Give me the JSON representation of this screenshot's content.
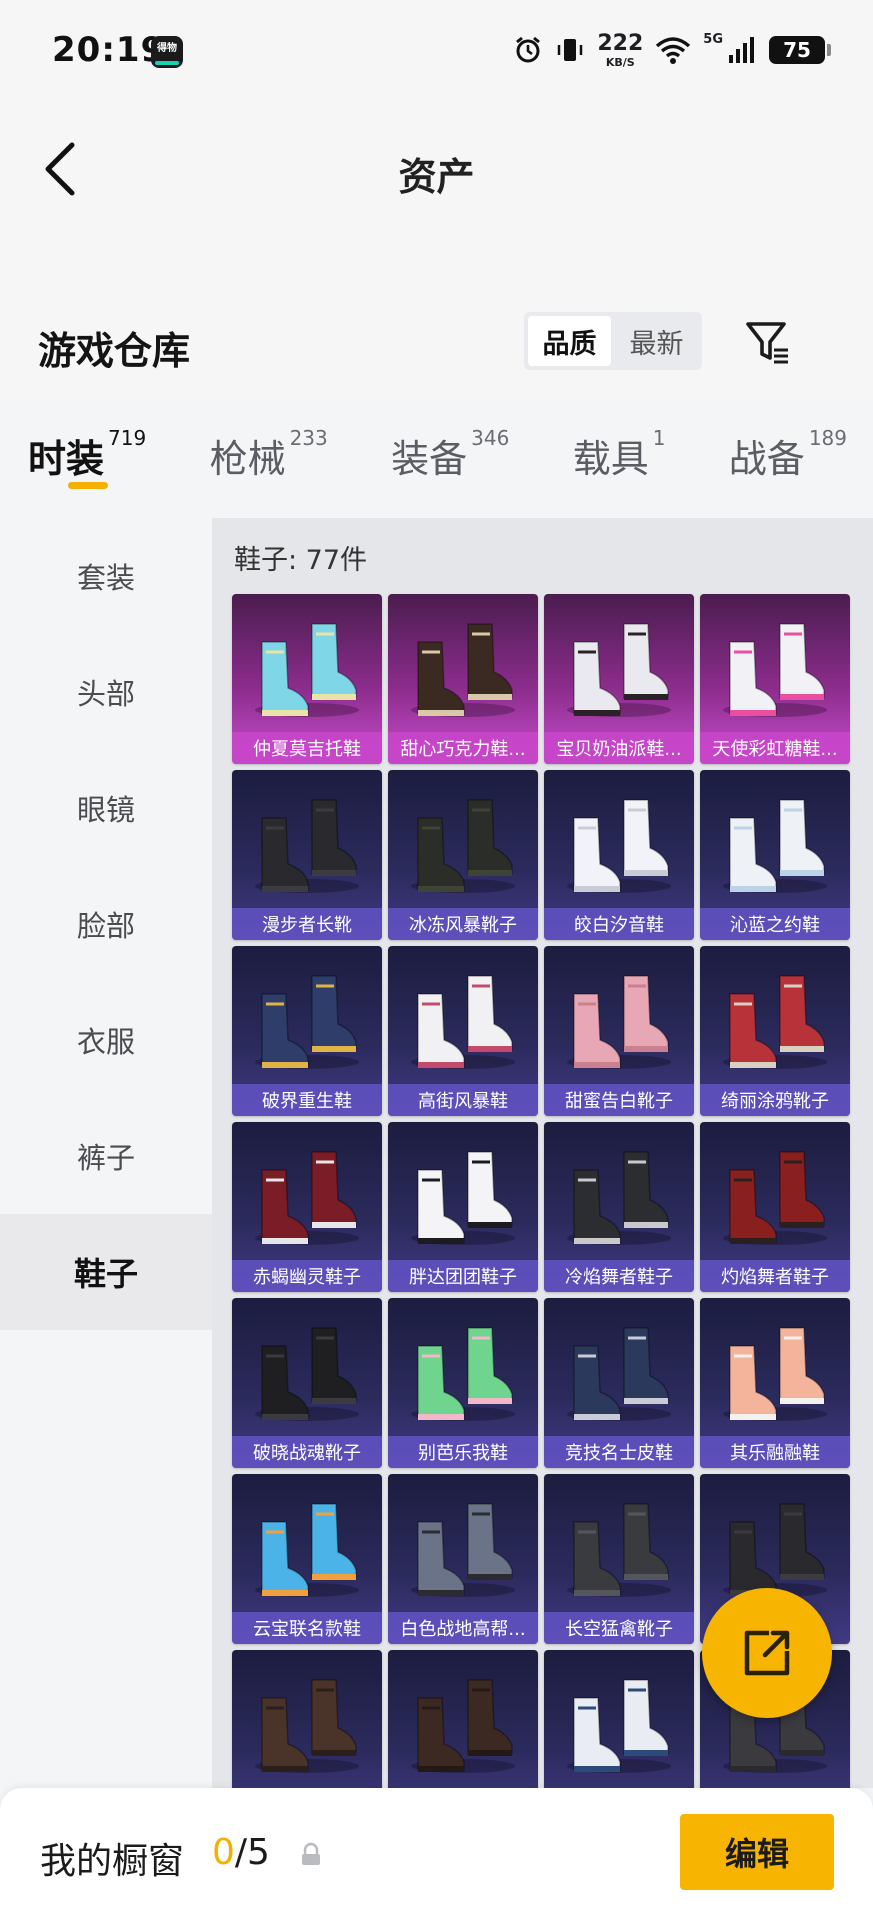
{
  "status_bar": {
    "time": "20:19",
    "app_badge_text": "得物",
    "net_speed_value": "222",
    "net_speed_unit": "KB/S",
    "network_type": "5G",
    "battery_level": "75",
    "icons": [
      "alarm-icon",
      "vibrate-icon",
      "wifi-icon",
      "signal-icon",
      "battery-icon"
    ]
  },
  "header": {
    "title": "资产",
    "back_icon": "chevron-left-icon"
  },
  "warehouse": {
    "title": "游戏仓库",
    "sort_options": [
      "品质",
      "最新"
    ],
    "sort_selected": "品质",
    "filter_icon": "filter-icon"
  },
  "tabs": [
    {
      "label": "时装",
      "count": "719",
      "active": true
    },
    {
      "label": "枪械",
      "count": "233",
      "active": false
    },
    {
      "label": "装备",
      "count": "346",
      "active": false
    },
    {
      "label": "载具",
      "count": "1",
      "active": false
    },
    {
      "label": "战备",
      "count": "189",
      "active": false
    }
  ],
  "sidebar": {
    "items": [
      "套装",
      "头部",
      "眼镜",
      "脸部",
      "衣服",
      "裤子",
      "鞋子"
    ],
    "selected": "鞋子"
  },
  "content": {
    "count_text": "鞋子: 77件",
    "items": [
      {
        "name": "仲夏莫吉托鞋",
        "rarity": "epic",
        "colors": [
          "#7fd6e6",
          "#e9e3a8"
        ]
      },
      {
        "name": "甜心巧克力鞋...",
        "rarity": "epic",
        "colors": [
          "#3b2a22",
          "#d8c9a8"
        ]
      },
      {
        "name": "宝贝奶油派鞋...",
        "rarity": "epic",
        "colors": [
          "#e9e9ef",
          "#2a2226"
        ]
      },
      {
        "name": "天使彩虹糖鞋...",
        "rarity": "epic",
        "colors": [
          "#f2f2f6",
          "#e94fa0"
        ]
      },
      {
        "name": "漫步者长靴",
        "rarity": "rare",
        "colors": [
          "#2a2a2e",
          "#3b3b40"
        ]
      },
      {
        "name": "冰冻风暴靴子",
        "rarity": "rare",
        "colors": [
          "#2b2e28",
          "#3e4336"
        ]
      },
      {
        "name": "皎白汐音鞋",
        "rarity": "rare",
        "colors": [
          "#f1f3f8",
          "#c9ccd6"
        ]
      },
      {
        "name": "沁蓝之约鞋",
        "rarity": "rare",
        "colors": [
          "#eef1f6",
          "#bcd2e6"
        ]
      },
      {
        "name": "破界重生鞋",
        "rarity": "rare",
        "colors": [
          "#2e3d6a",
          "#e0b347"
        ]
      },
      {
        "name": "高街风暴鞋",
        "rarity": "rare",
        "colors": [
          "#f1f1f4",
          "#c24a6a"
        ]
      },
      {
        "name": "甜蜜告白靴子",
        "rarity": "rare",
        "colors": [
          "#e7a7b5",
          "#c9808f"
        ]
      },
      {
        "name": "绮丽涂鸦靴子",
        "rarity": "rare",
        "colors": [
          "#b8323a",
          "#d9d0c2"
        ]
      },
      {
        "name": "赤蝎幽灵鞋子",
        "rarity": "rare",
        "colors": [
          "#7a1d26",
          "#e6e6ea"
        ]
      },
      {
        "name": "胖达团团鞋子",
        "rarity": "rare",
        "colors": [
          "#f4f4f6",
          "#1c1c20"
        ]
      },
      {
        "name": "冷焰舞者鞋子",
        "rarity": "rare",
        "colors": [
          "#2b2d30",
          "#c9c9cc"
        ]
      },
      {
        "name": "灼焰舞者鞋子",
        "rarity": "rare",
        "colors": [
          "#8a1f1f",
          "#2a2020"
        ]
      },
      {
        "name": "破晓战魂靴子",
        "rarity": "rare",
        "colors": [
          "#1f1f22",
          "#3a3a3f"
        ]
      },
      {
        "name": "别芭乐我鞋",
        "rarity": "rare",
        "colors": [
          "#6fd48d",
          "#f2b7c9"
        ]
      },
      {
        "name": "竞技名士皮鞋",
        "rarity": "rare",
        "colors": [
          "#2b3a5c",
          "#c9ccd6"
        ]
      },
      {
        "name": "其乐融融鞋",
        "rarity": "rare",
        "colors": [
          "#f3b49b",
          "#f4f1ee"
        ]
      },
      {
        "name": "云宝联名款鞋",
        "rarity": "rare",
        "colors": [
          "#4cb3e8",
          "#f2a03c"
        ]
      },
      {
        "name": "白色战地高帮...",
        "rarity": "rare",
        "colors": [
          "#6a7388",
          "#2b2b30"
        ]
      },
      {
        "name": "长空猛禽靴子",
        "rarity": "rare",
        "colors": [
          "#3a3b3f",
          "#55565c"
        ]
      },
      {
        "name": "",
        "rarity": "rare",
        "colors": [
          "#2a2a2e",
          "#3b3b40"
        ]
      },
      {
        "name": "",
        "rarity": "rare",
        "colors": [
          "#4a3328",
          "#2a1f1b"
        ]
      },
      {
        "name": "",
        "rarity": "rare",
        "colors": [
          "#3c2a22",
          "#231a16"
        ]
      },
      {
        "name": "",
        "rarity": "rare",
        "colors": [
          "#e9ecf3",
          "#2c4a7a"
        ]
      },
      {
        "name": "",
        "rarity": "rare",
        "colors": [
          "#3a3a3f",
          "#2a2a2e"
        ]
      }
    ]
  },
  "fab": {
    "icon": "share-external-icon"
  },
  "bottom_bar": {
    "showcase_label": "我的橱窗",
    "showcase_current": "0",
    "showcase_total": "/5",
    "lock_icon": "lock-icon",
    "edit_label": "编辑"
  }
}
